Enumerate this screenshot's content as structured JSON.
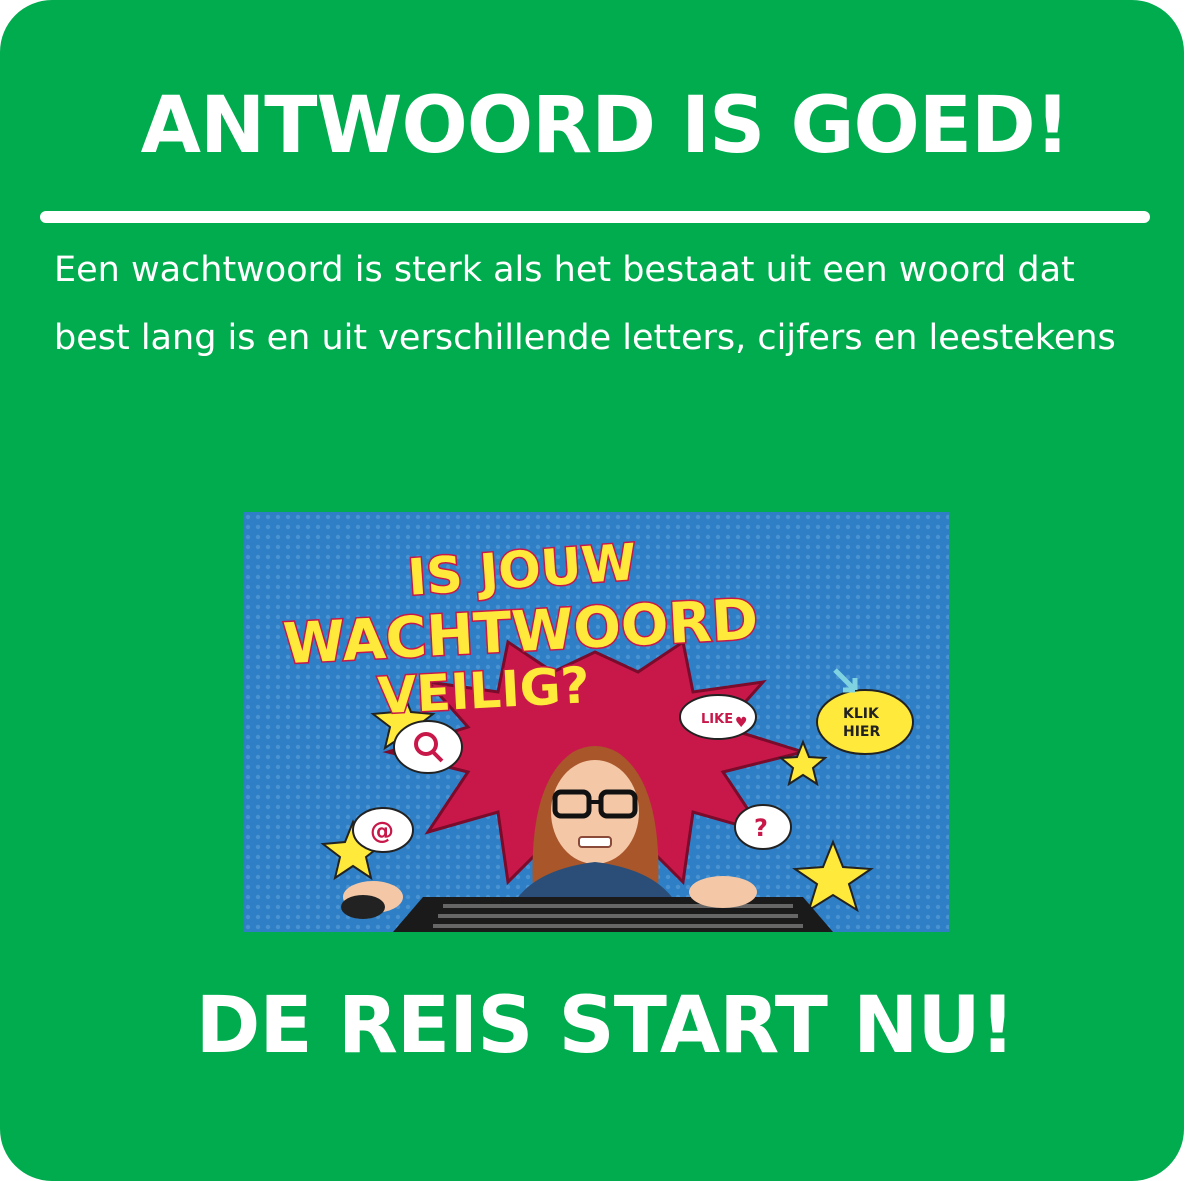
{
  "header": {
    "title": "ANTWOORD IS GOED!"
  },
  "explanation": {
    "text": "Een wachtwoord is sterk als het bestaat uit een woord dat best lang is en uit verschillende letters, cijfers en leestekens"
  },
  "poster": {
    "headline_line1": "IS JOUW",
    "headline_line2": "WACHTWOORD",
    "headline_line3": "VEILIG?",
    "like_label": "LIKE",
    "klik_label_line1": "KLIK",
    "klik_label_line2": "HIER",
    "question_mark": "?",
    "at_sign": "@"
  },
  "footer": {
    "cta": "DE REIS START NU!"
  },
  "colors": {
    "card_background": "#00AC4E",
    "text": "#FFFFFF",
    "poster_blue": "#2E7FC6",
    "poster_yellow": "#FFE93A",
    "poster_red": "#C8184A"
  }
}
